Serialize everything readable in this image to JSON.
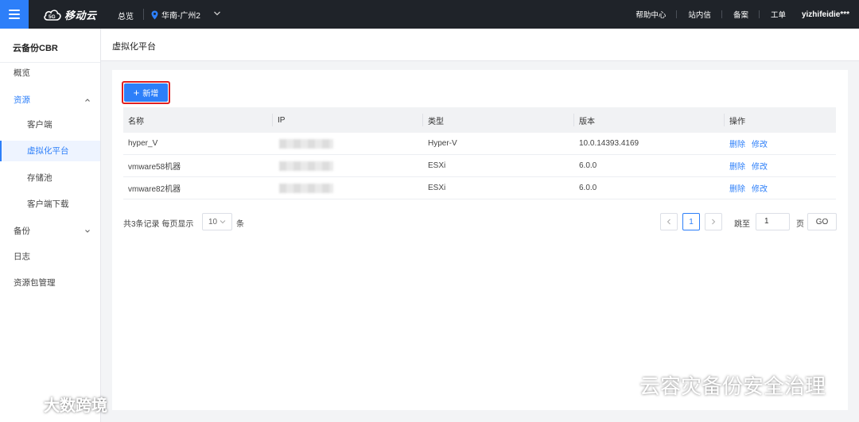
{
  "topbar": {
    "logo_badge": "5G",
    "logo_text": "移动云",
    "overview": "总览",
    "region": "华南-广州2",
    "links": [
      "帮助中心",
      "站内信",
      "备案",
      "工单"
    ],
    "user": "yizhifeidie***",
    "accent_color": "#2d7ff9",
    "bg_color": "#1f2329"
  },
  "sidebar": {
    "title": "云备份CBR",
    "items": [
      {
        "label": "概览"
      },
      {
        "label": "资源"
      },
      {
        "label": "客户端"
      },
      {
        "label": "虚拟化平台"
      },
      {
        "label": "存储池"
      },
      {
        "label": "客户端下载"
      },
      {
        "label": "备份"
      },
      {
        "label": "日志"
      },
      {
        "label": "资源包管理"
      }
    ]
  },
  "page": {
    "title": "虚拟化平台"
  },
  "toolbar": {
    "add_label": "新增"
  },
  "table": {
    "columns": [
      "名称",
      "IP",
      "类型",
      "版本",
      "操作"
    ],
    "rows": [
      {
        "name": "hyper_V",
        "type": "Hyper-V",
        "version": "10.0.14393.4169"
      },
      {
        "name": "vmware58机器",
        "type": "ESXi",
        "version": "6.0.0"
      },
      {
        "name": "vmware82机器",
        "type": "ESXi",
        "version": "6.0.0"
      }
    ],
    "actions": {
      "delete": "删除",
      "edit": "修改"
    }
  },
  "pagination": {
    "summary": "共3条记录 每页显示",
    "page_size": "10",
    "unit": "条",
    "current_page": "1",
    "goto_label": "跳至",
    "goto_value": "1",
    "page_label": "页",
    "go_label": "GO"
  },
  "watermarks": {
    "right": "云容灾备份安全治理",
    "left": "大数跨境"
  }
}
